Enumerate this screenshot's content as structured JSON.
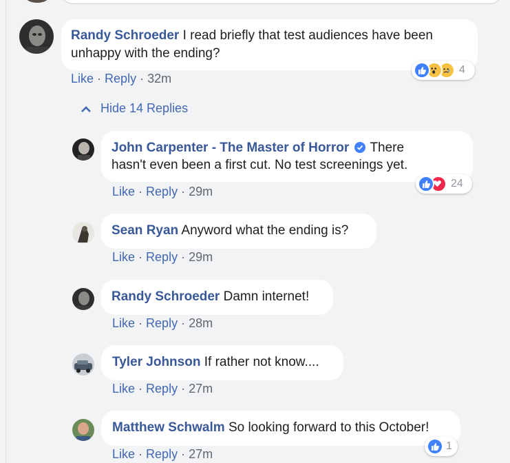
{
  "comment": {
    "author": "Randy Schroeder",
    "text": "I read briefly that test audiences have been unhappy with the ending?",
    "like": "Like",
    "reply": "Reply",
    "sep": "·",
    "time": "32m",
    "reaction_count": "4",
    "reaction_icons": [
      "like-icon",
      "wow-icon",
      "sad-icon"
    ]
  },
  "hide_replies": "Hide 14 Replies",
  "replies": [
    {
      "author": "John Carpenter - The Master of Horror",
      "verified": true,
      "text_line1": "There",
      "text_line2": "hasn't even been a first cut. No test screenings yet.",
      "like": "Like",
      "reply": "Reply",
      "sep": "·",
      "time": "29m",
      "reaction_count": "24",
      "reaction_icons": [
        "like-icon",
        "love-icon"
      ]
    },
    {
      "author": "Sean Ryan",
      "text": "Anyword what the ending is?",
      "like": "Like",
      "reply": "Reply",
      "sep": "·",
      "time": "29m"
    },
    {
      "author": "Randy Schroeder",
      "text": "Damn internet!",
      "like": "Like",
      "reply": "Reply",
      "sep": "·",
      "time": "28m"
    },
    {
      "author": "Tyler Johnson",
      "text": "If rather not know....",
      "like": "Like",
      "reply": "Reply",
      "sep": "·",
      "time": "27m"
    },
    {
      "author": "Matthew Schwalm",
      "text": "So looking forward to this October!",
      "like": "Like",
      "reply": "Reply",
      "sep": "·",
      "time": "27m",
      "reaction_count": "1",
      "reaction_icons": [
        "like-icon"
      ]
    }
  ],
  "colors": {
    "link": "#385898",
    "action": "#4267b2",
    "muted": "#606770",
    "background": "#f2f3f5",
    "like_blue": "#4080ff",
    "love_red": "#f0284a",
    "wow_yellow": "#f7c244"
  }
}
